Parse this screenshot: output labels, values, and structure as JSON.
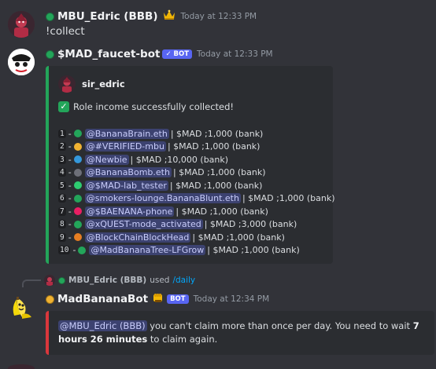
{
  "messages": {
    "m1": {
      "author": "MBU_Edric (BBB)",
      "timestamp": "Today at 12:33 PM",
      "content": "!collect"
    },
    "m2": {
      "author": "$MAD_faucet-bot",
      "bot_tag": "✓ BOT",
      "timestamp": "Today at 12:33 PM",
      "embed": {
        "author": "sir_edric",
        "description": "Role income successfully collected!",
        "rows": [
          {
            "num": "1",
            "role": "@BananaBrain.eth",
            "dot": "#23a55a",
            "rest": "| $MAD ;1,000 (bank)"
          },
          {
            "num": "2",
            "role": "@#VERIFIED-mbu",
            "dot": "#f0b232",
            "rest": "| $MAD ;1,000 (bank)"
          },
          {
            "num": "3",
            "role": "@Newbie",
            "dot": "#3498db",
            "rest": "| $MAD ;10,000 (bank)"
          },
          {
            "num": "4",
            "role": "@BananaBomb.eth",
            "dot": "#6d6f78",
            "rest": "| $MAD ;1,000 (bank)"
          },
          {
            "num": "5",
            "role": "@$MAD-lab_tester",
            "dot": "#2ecc71",
            "rest": "| $MAD ;1,000 (bank)"
          },
          {
            "num": "6",
            "role": "@smokers-lounge.BananaBlunt.eth",
            "dot": "#23a55a",
            "rest": "| $MAD ;1,000 (bank)"
          },
          {
            "num": "7",
            "role": "@$BAENANA-phone",
            "dot": "#e91e63",
            "rest": "| $MAD ;1,000 (bank)"
          },
          {
            "num": "8",
            "role": "@xQUEST-mode_activated",
            "dot": "#23a55a",
            "rest": "| $MAD ;3,000 (bank)"
          },
          {
            "num": "9",
            "role": "@BlockChainBlockHead",
            "dot": "#e67e22",
            "rest": "| $MAD ;1,000 (bank)"
          },
          {
            "num": "10",
            "role": "@MadBananaTree-LFGrow",
            "dot": "#23a55a",
            "rest": "| $MAD ;1,000 (bank)"
          }
        ]
      }
    },
    "m3": {
      "reply_user": "MBU_Edric (BBB)",
      "reply_used": "used",
      "reply_command": "/daily",
      "author": "MadBananaBot",
      "bot_tag": "BOT",
      "timestamp": "Today at 12:34 PM",
      "embed": {
        "mention": "@MBU_Edric (BBB)",
        "text_before": " you can't claim more than once per day. You need to wait ",
        "bold": "7 hours 26 minutes",
        "text_after": " to claim again."
      }
    }
  },
  "icons": {
    "m1_badge": "crown-emoji-icon",
    "m3_badge": "fist-emoji-icon"
  },
  "colors": {
    "background": "#323339",
    "embed_bg": "#2b2d31",
    "online": "#23a55a",
    "idle": "#f0b232",
    "bot_tag": "#5865f2",
    "error_bar": "#da373c",
    "mention_bg": "#3c4270",
    "link": "#00a8fc"
  }
}
